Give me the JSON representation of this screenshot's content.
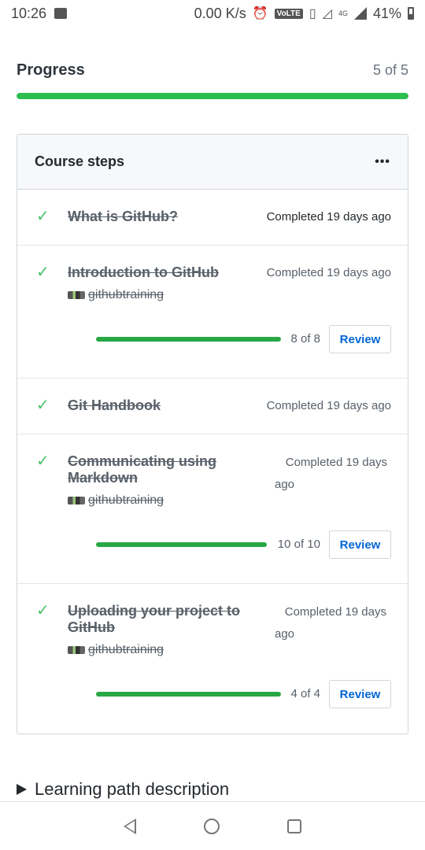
{
  "status_bar": {
    "time": "10:26",
    "network_speed": "0.00 K/s",
    "volte": "VoLTE",
    "network_type": "4G",
    "battery": "41%",
    "icons": [
      "image-icon",
      "alarm-icon",
      "volte-icon",
      "vibrate-icon",
      "signal-icon",
      "signal-4g-icon",
      "battery-icon"
    ]
  },
  "progress": {
    "title": "Progress",
    "count": "5 of 5",
    "fraction": 1.0,
    "color": "#2cbe4e"
  },
  "course_steps": {
    "title": "Course steps",
    "more_icon": "more-horizontal-icon",
    "steps": [
      {
        "title": "What is GitHub?",
        "status": "Completed 19 days ago",
        "has_repo": false
      },
      {
        "title": "Introduction to GitHub",
        "status": "Completed 19 days ago",
        "owner": "githubtraining",
        "progress": "8 of 8",
        "fraction": 1.0,
        "review": "Review"
      },
      {
        "title": "Git Handbook",
        "status": "Completed 19 days ago",
        "has_repo": false
      },
      {
        "title_line1": "Communicating using",
        "title_line2": "Markdown",
        "status_line1": "Completed 19 days",
        "status_line2": "ago",
        "owner": "githubtraining",
        "progress": "10 of 10",
        "fraction": 1.0,
        "review": "Review"
      },
      {
        "title_line1": "Uploading your project to",
        "title_line2": "GitHub",
        "status_line1": "Completed 19 days",
        "status_line2": "ago",
        "owner": "githubtraining",
        "progress": "4 of 4",
        "fraction": 1.0,
        "review": "Review"
      }
    ]
  },
  "description": {
    "label": "Learning path description",
    "icon": "triangle-right-icon"
  },
  "nav_bar": {
    "icons": [
      "back-icon",
      "home-icon",
      "recents-icon"
    ]
  },
  "colors": {
    "check": "#4ac26b",
    "link": "#0366d6",
    "bar": "#28a745"
  }
}
